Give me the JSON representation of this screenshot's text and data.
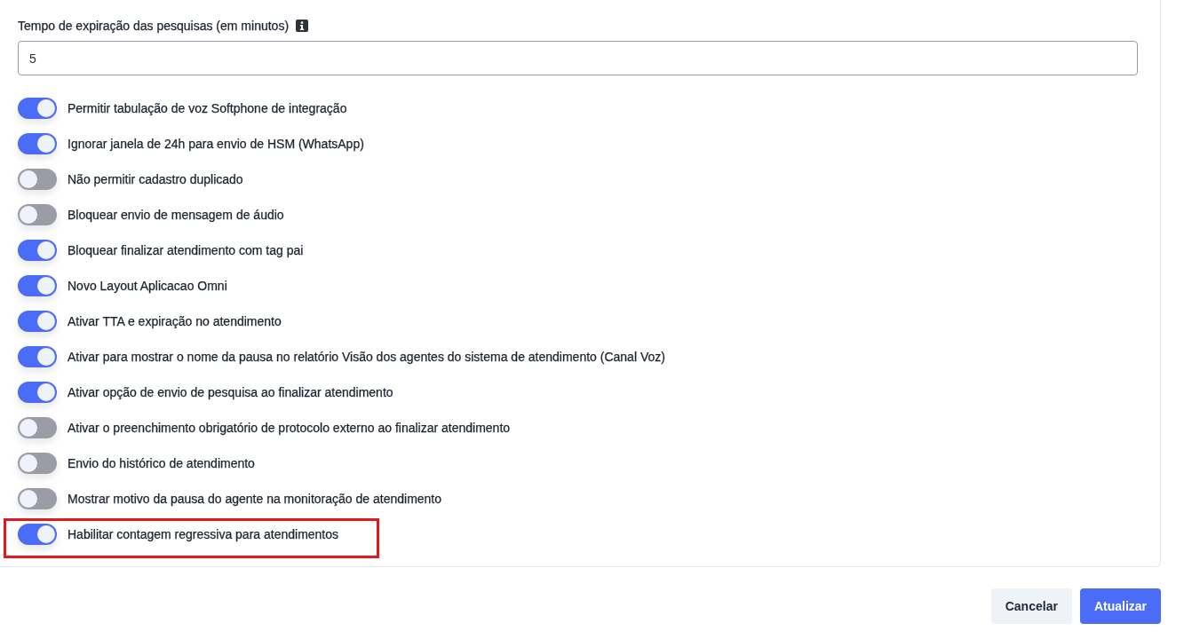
{
  "survey_timeout": {
    "label": "Tempo de expiração das pesquisas (em minutos)",
    "value": "5"
  },
  "toggles": [
    {
      "label": "Permitir tabulação de voz Softphone de integração",
      "on": true,
      "highlighted": false
    },
    {
      "label": "Ignorar janela de 24h para envio de HSM (WhatsApp)",
      "on": true,
      "highlighted": false
    },
    {
      "label": "Não permitir cadastro duplicado",
      "on": false,
      "highlighted": false
    },
    {
      "label": "Bloquear envio de mensagem de áudio",
      "on": false,
      "highlighted": false
    },
    {
      "label": "Bloquear finalizar atendimento com tag pai",
      "on": true,
      "highlighted": false
    },
    {
      "label": "Novo Layout Aplicacao Omni",
      "on": true,
      "highlighted": false
    },
    {
      "label": "Ativar TTA e expiração no atendimento",
      "on": true,
      "highlighted": false
    },
    {
      "label": "Ativar para mostrar o nome da pausa no relatório Visão dos agentes do sistema de atendimento (Canal Voz)",
      "on": true,
      "highlighted": false
    },
    {
      "label": "Ativar opção de envio de pesquisa ao finalizar atendimento",
      "on": true,
      "highlighted": false
    },
    {
      "label": "Ativar o preenchimento obrigatório de protocolo externo ao finalizar atendimento",
      "on": false,
      "highlighted": false
    },
    {
      "label": "Envio do histórico de atendimento",
      "on": false,
      "highlighted": false
    },
    {
      "label": "Mostrar motivo da pausa do agente na monitoração de atendimento",
      "on": false,
      "highlighted": false
    },
    {
      "label": "Habilitar contagem regressiva para atendimentos",
      "on": true,
      "highlighted": true
    }
  ],
  "buttons": [
    {
      "label": "Cancelar",
      "kind": "secondary"
    },
    {
      "label": "Atualizar",
      "kind": "primary"
    }
  ]
}
